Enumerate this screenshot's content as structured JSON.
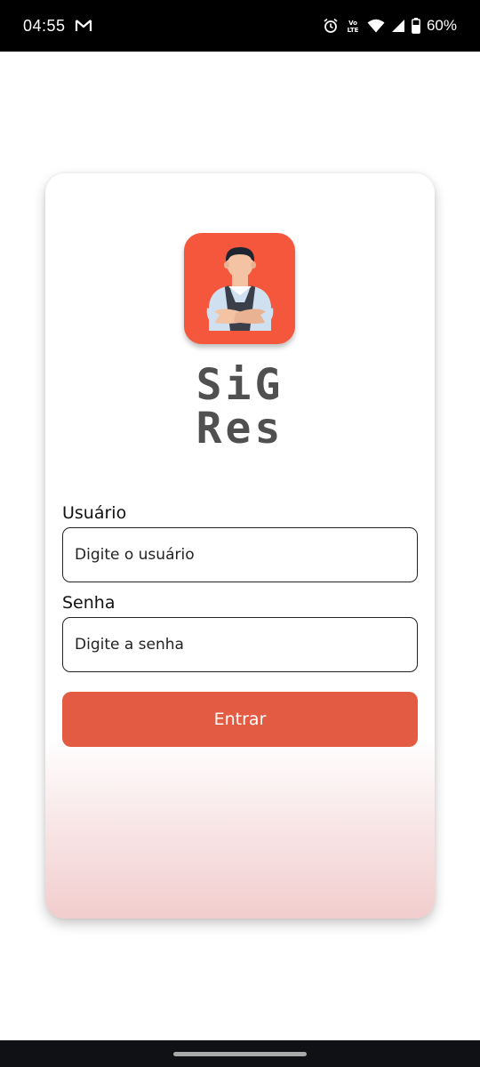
{
  "status_bar": {
    "time": "04:55",
    "notification_icon": "gmail-icon",
    "icons": [
      "alarm-icon",
      "volte-icon",
      "wifi-icon",
      "cell-signal-icon",
      "battery-icon"
    ],
    "volte_label": "Vo LTE",
    "battery_percent": "60%"
  },
  "login_card": {
    "logo_icon": "chef-avatar-icon",
    "app_name_line1": "SiG",
    "app_name_line2": "Res",
    "username": {
      "label": "Usuário",
      "placeholder": "Digite o usuário",
      "value": ""
    },
    "password": {
      "label": "Senha",
      "placeholder": "Digite a senha",
      "value": ""
    },
    "submit_label": "Entrar"
  },
  "colors": {
    "brand_orange": "#f4573c",
    "button": "#e45b43",
    "title_text": "#505050",
    "gradient_bottom": "#f2cdcd"
  }
}
